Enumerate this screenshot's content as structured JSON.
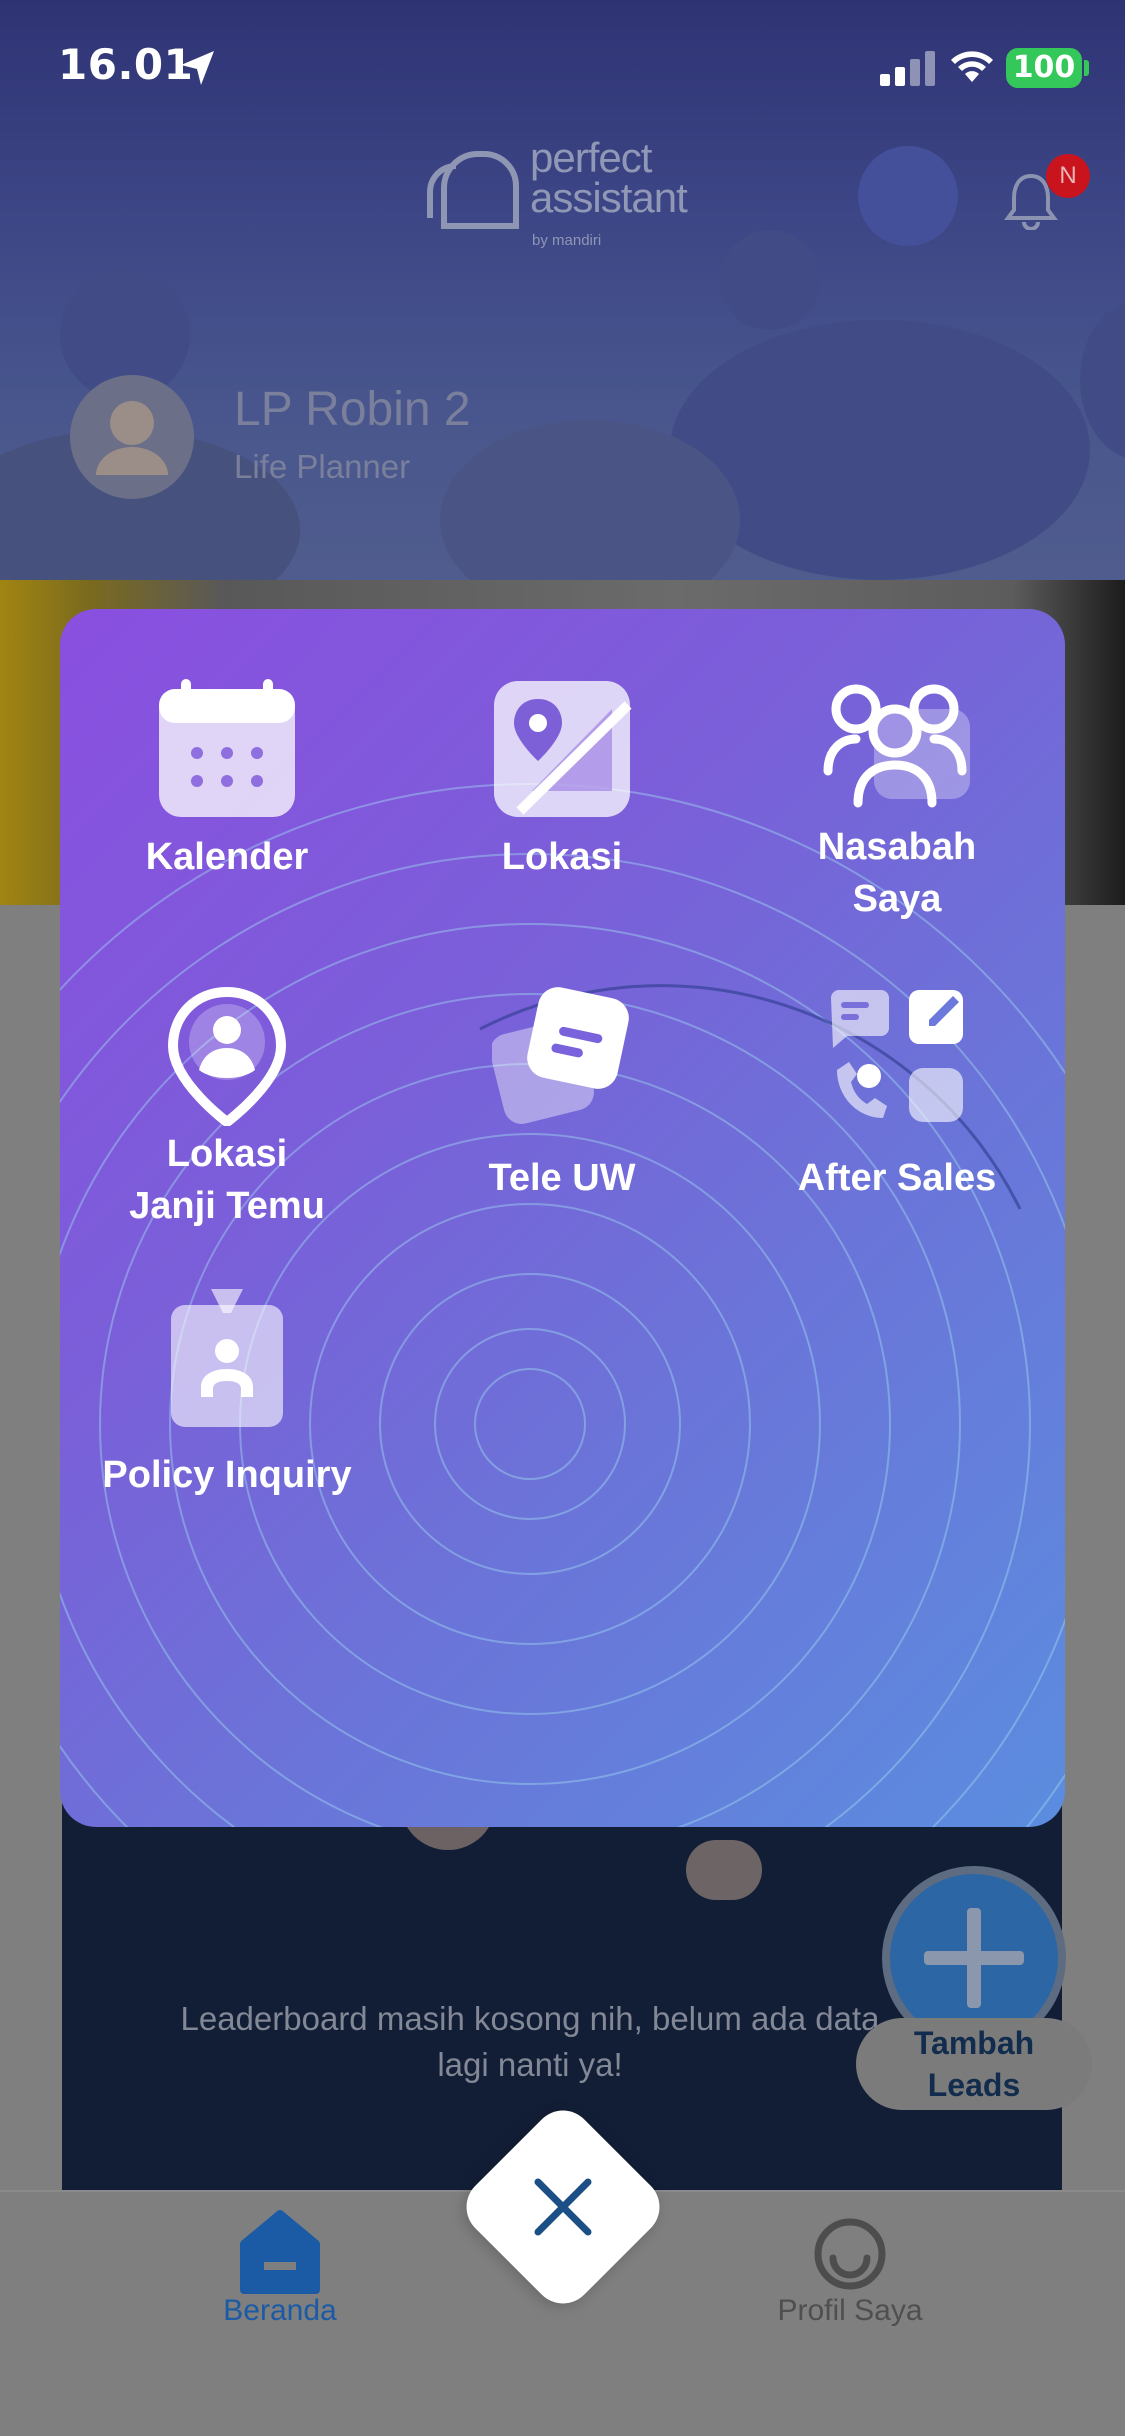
{
  "status_bar": {
    "time": "16.01",
    "battery": "100"
  },
  "header": {
    "logo_line1": "perfect",
    "logo_line2": "assistant",
    "logo_by": "by mandiri",
    "notification_badge": "N",
    "user_name": "LP Robin  2",
    "user_role": "Life Planner"
  },
  "menu": {
    "items": [
      {
        "label": "Kalender",
        "icon": "calendar-icon"
      },
      {
        "label": "Lokasi",
        "icon": "map-image-icon"
      },
      {
        "label_line1": "Nasabah",
        "label_line2": "Saya",
        "icon": "people-group-icon"
      },
      {
        "label_line1": "Lokasi",
        "label_line2": "Janji Temu",
        "icon": "location-person-pin-icon"
      },
      {
        "label": "Tele UW",
        "icon": "tele-uw-card-icon"
      },
      {
        "label": "After Sales",
        "icon": "after-sales-icon"
      },
      {
        "label": "Policy Inquiry",
        "icon": "id-badge-icon"
      }
    ]
  },
  "leaderboard": {
    "empty_line1": "Leaderboard masih kosong nih, belum ada data",
    "empty_line2": "lagi nanti ya!"
  },
  "fab": {
    "line1": "Tambah",
    "line2": "Leads"
  },
  "bottom_nav": {
    "home": "Beranda",
    "profile": "Profil Saya"
  },
  "colors": {
    "panel_start": "#8a4fe0",
    "panel_end": "#5b8ddf",
    "nav_active": "#1b5aa4",
    "badge": "#c9141e",
    "battery": "#34c759"
  }
}
